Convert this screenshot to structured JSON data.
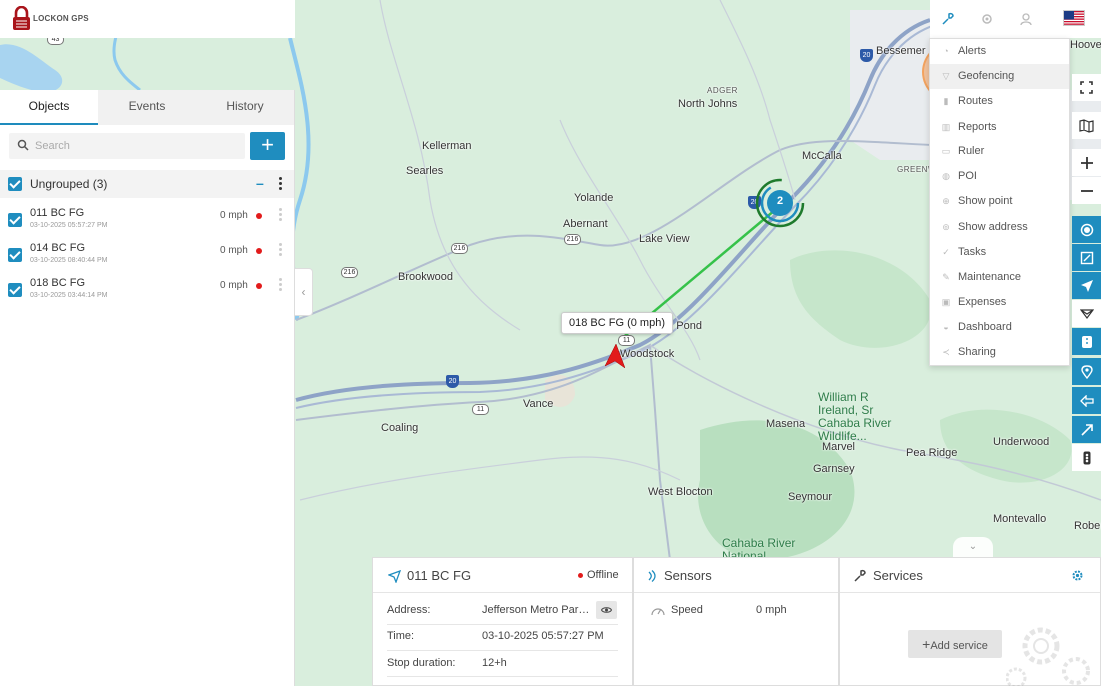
{
  "app": {
    "logo_text": "LOCKON GPS"
  },
  "tabs": [
    {
      "label": "Objects",
      "active": true
    },
    {
      "label": "Events",
      "active": false
    },
    {
      "label": "History",
      "active": false
    }
  ],
  "search": {
    "placeholder": "Search",
    "add_label": "+"
  },
  "group": {
    "label": "Ungrouped (3)",
    "collapse": "–"
  },
  "objects": [
    {
      "name": "011 BC FG",
      "time": "03-10-2025 05:57:27 PM",
      "speed": "0 mph",
      "status_color": "#e21b1b"
    },
    {
      "name": "014 BC FG",
      "time": "03-10-2025 08:40:44 PM",
      "speed": "0 mph",
      "status_color": "#e21b1b"
    },
    {
      "name": "018 BC FG",
      "time": "03-10-2025 03:44:14 PM",
      "speed": "0 mph",
      "status_color": "#e21b1b"
    }
  ],
  "map": {
    "cluster_count": "2",
    "marker_label": "018 BC FG (0 mph)",
    "places": {
      "bessemer": "Bessemer",
      "hoover": "Hoove",
      "adger": "ADGER",
      "north_johns": "North Johns",
      "kellerman": "Kellerman",
      "searles": "Searles",
      "mccalla": "McCalla",
      "greenwood": "GREENW",
      "yolande": "Yolande",
      "abernant": "Abernant",
      "lake_view": "Lake View",
      "brookwood": "Brookwood",
      "pond": "on Pond",
      "woodstock": "Woodstock",
      "vance": "Vance",
      "coaling": "Coaling",
      "wildlife": "William R\nIreland, Sr\nCahaba River\nWildlife...",
      "masena": "Masena",
      "marvel": "Marvel",
      "underwood": "Underwood",
      "pea_ridge": "Pea Ridge",
      "garnsey": "Garnsey",
      "seymour": "Seymour",
      "west_blocton": "West Blocton",
      "montevallo": "Montevallo",
      "roberts": "Rober",
      "cahaba_national": "Cahaba River\nNational"
    },
    "shields": {
      "r43": "43",
      "r20a": "20",
      "r20b": "20",
      "r216a": "216",
      "r216b": "216",
      "r216c": "216",
      "r20c": "20",
      "r11a": "11",
      "r11b": "11"
    }
  },
  "menu": [
    {
      "label": "Alerts",
      "icon": "alert-icon"
    },
    {
      "label": "Geofencing",
      "icon": "geofence-icon",
      "hover": true
    },
    {
      "label": "Routes",
      "icon": "route-icon"
    },
    {
      "label": "Reports",
      "icon": "report-icon"
    },
    {
      "label": "Ruler",
      "icon": "ruler-icon"
    },
    {
      "label": "POI",
      "icon": "poi-icon"
    },
    {
      "label": "Show point",
      "icon": "point-icon"
    },
    {
      "label": "Show address",
      "icon": "address-icon"
    },
    {
      "label": "Tasks",
      "icon": "task-icon"
    },
    {
      "label": "Maintenance",
      "icon": "maintenance-icon"
    },
    {
      "label": "Expenses",
      "icon": "expense-icon"
    },
    {
      "label": "Dashboard",
      "icon": "dashboard-icon"
    },
    {
      "label": "Sharing",
      "icon": "share-icon"
    }
  ],
  "details": {
    "title": "011 BC FG",
    "status": "Offline",
    "rows": [
      {
        "key": "Address:",
        "value": "Jefferson Metro Parkw..."
      },
      {
        "key": "Time:",
        "value": "03-10-2025 05:57:27 PM"
      },
      {
        "key": "Stop duration:",
        "value": "12+h"
      }
    ]
  },
  "sensors": {
    "title": "Sensors",
    "rows": [
      {
        "key": "Speed",
        "value": "0 mph"
      }
    ]
  },
  "services": {
    "title": "Services",
    "add_label": "Add service"
  },
  "colors": {
    "accent": "#1f8dbf",
    "offline": "#e21b1b",
    "route": "#36c24a"
  }
}
